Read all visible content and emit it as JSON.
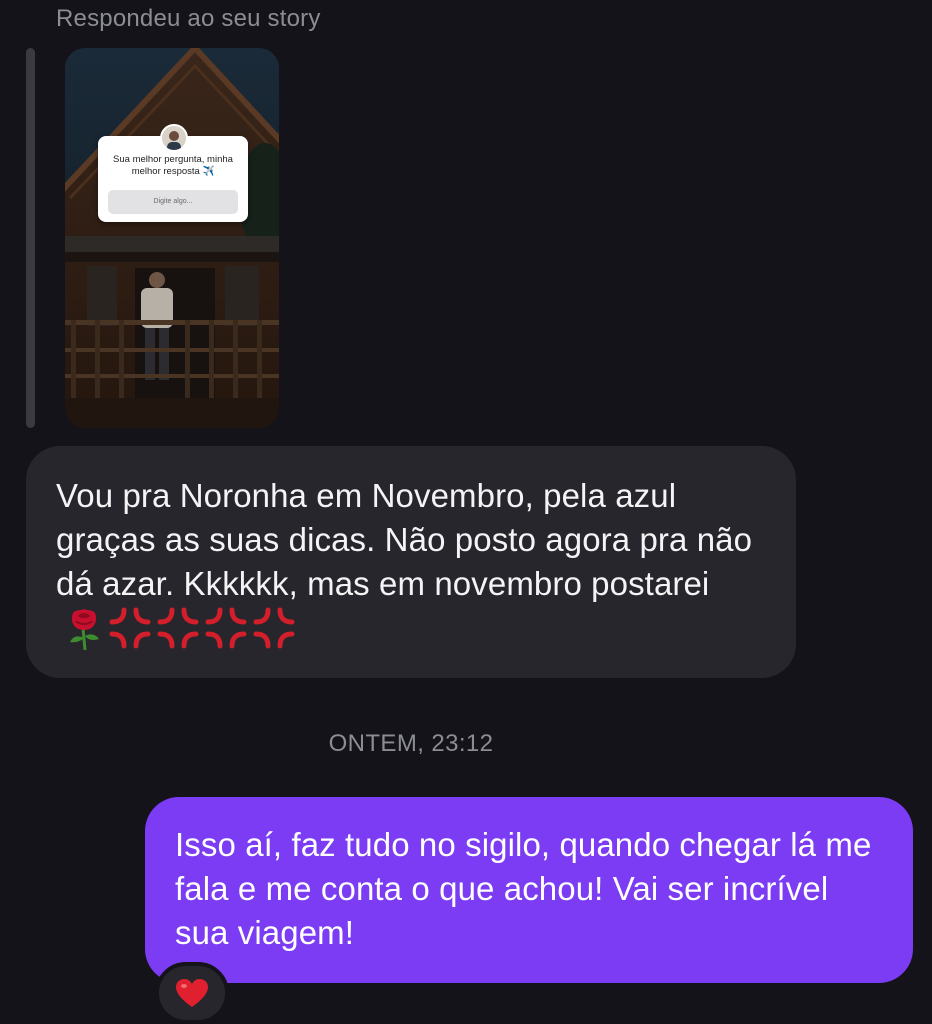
{
  "story_reply": {
    "label": "Respondeu ao seu story",
    "question_box": {
      "prompt": "Sua melhor pergunta, minha melhor resposta ✈️",
      "placeholder": "Digite algo..."
    }
  },
  "messages": [
    {
      "direction": "incoming",
      "text": "Vou pra Noronha em Novembro, pela azul graças as suas dicas. Não posto agora pra não dá azar. Kkkkkk, mas em novembro postarei",
      "emojis": [
        "rose-icon",
        "anger-symbol-icon",
        "anger-symbol-icon",
        "anger-symbol-icon",
        "anger-symbol-icon"
      ]
    },
    {
      "direction": "outgoing",
      "text": "Isso aí, faz tudo no sigilo, quando chegar lá me fala e me conta o que achou! Vai ser incrível sua viagem!",
      "reaction": "red-heart-icon"
    }
  ],
  "timestamp": "ONTEM, 23:12",
  "colors": {
    "background": "#131319",
    "incoming_bubble": "#26262c",
    "outgoing_bubble": "#7b3cf3",
    "secondary_text": "#8c8c95"
  }
}
